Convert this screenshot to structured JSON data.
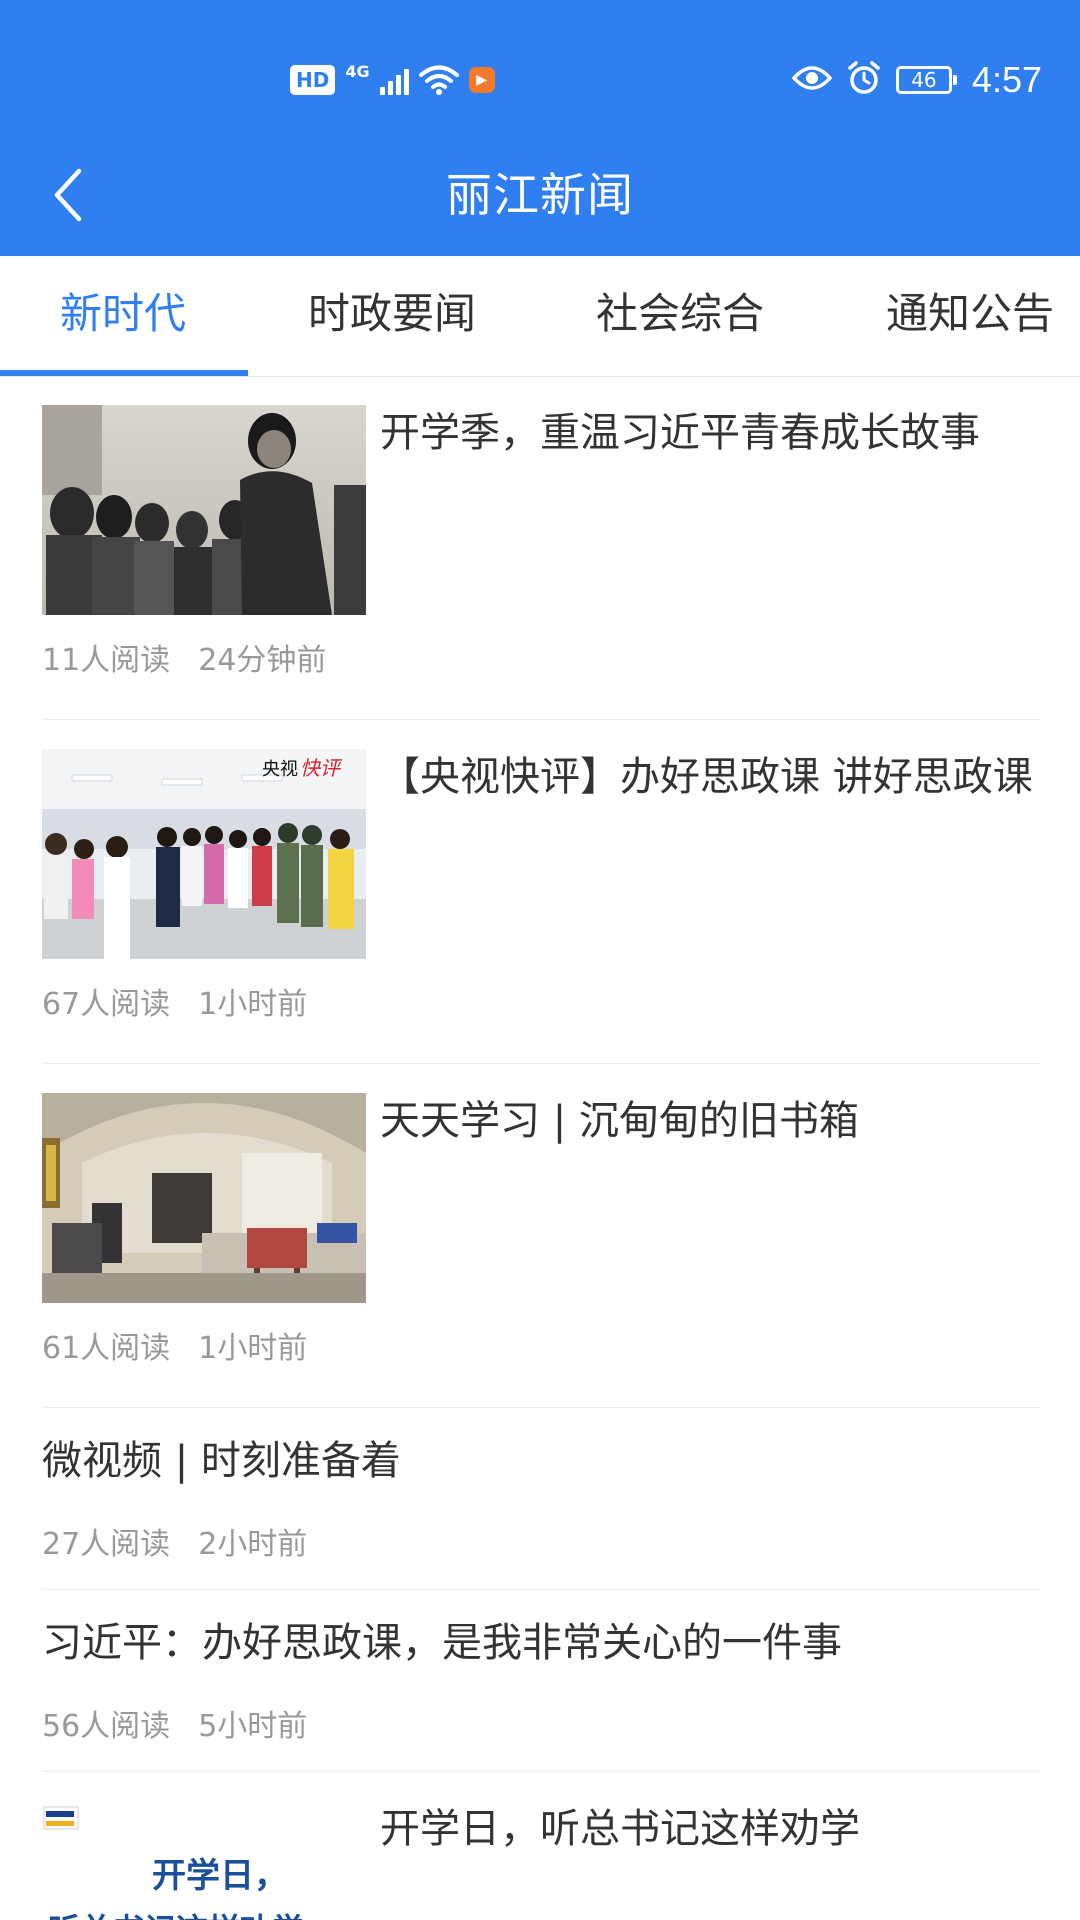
{
  "status_bar": {
    "hd": "HD",
    "network": "4G",
    "battery": "46",
    "time": "4:57"
  },
  "header": {
    "title": "丽江新闻"
  },
  "tabs": [
    {
      "label": "新时代",
      "active": true
    },
    {
      "label": "时政要闻",
      "active": false
    },
    {
      "label": "社会综合",
      "active": false
    },
    {
      "label": "通知公告",
      "active": false
    }
  ],
  "articles": [
    {
      "title": "开学季，重温习近平青春成长故事",
      "reads": "11人阅读",
      "time": "24分钟前",
      "has_image": true,
      "image": "black-and-white-photo-crowd"
    },
    {
      "title": "【央视快评】办好思政课 讲好思政课",
      "reads": "67人阅读",
      "time": "1小时前",
      "has_image": true,
      "image": "classroom-meeting-photo",
      "image_caption_black": "央视",
      "image_caption_red": "快评"
    },
    {
      "title": "天天学习 | 沉甸甸的旧书箱",
      "reads": "61人阅读",
      "time": "1小时前",
      "has_image": true,
      "image": "cave-dwelling-room-photo"
    },
    {
      "title": "微视频 | 时刻准备着",
      "reads": "27人阅读",
      "time": "2小时前",
      "has_image": false
    },
    {
      "title": "习近平：办好思政课，是我非常关心的一件事",
      "reads": "56人阅读",
      "time": "5小时前",
      "has_image": false
    },
    {
      "title": "开学日，听总书记这样劝学",
      "has_image": true,
      "image": "poster-text",
      "image_text_1": "开学日，",
      "image_text_2": "听总书记这样劝学"
    }
  ]
}
